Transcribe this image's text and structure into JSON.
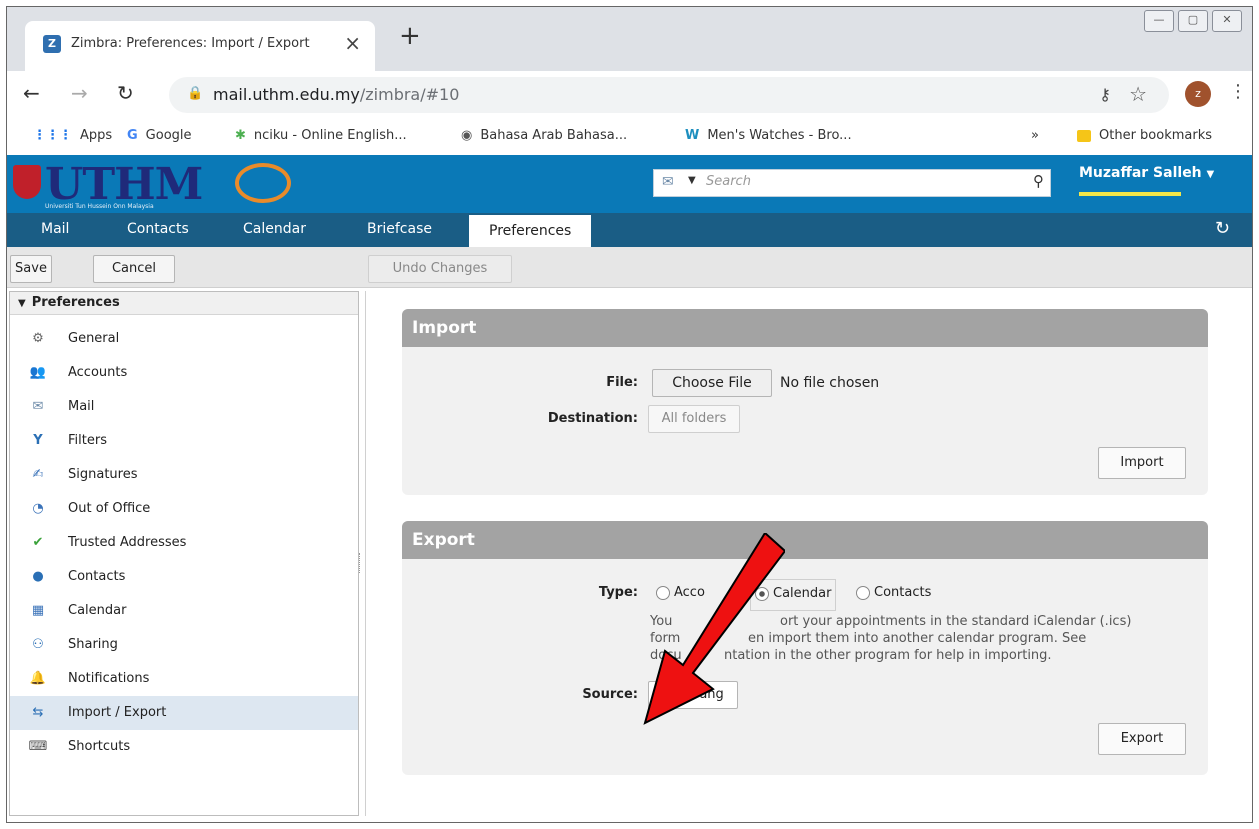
{
  "browser": {
    "tab_title": "Zimbra: Preferences: Import / Export",
    "favicon_text": "Z",
    "url_host": "mail.uthm.edu.my",
    "url_path": "/zimbra/#10",
    "avatar_letter": "z",
    "bookmarks": [
      {
        "label": "Apps",
        "icon": "apps-grid-icon"
      },
      {
        "label": "Google",
        "icon": "google-icon"
      },
      {
        "label": "nciku - Online English...",
        "icon": "nciku-icon"
      },
      {
        "label": "Bahasa Arab Bahasa...",
        "icon": "globe-icon"
      },
      {
        "label": "Men's Watches - Bro...",
        "icon": "w-icon"
      }
    ],
    "more_bookmarks": "»",
    "other_bookmarks": "Other bookmarks"
  },
  "header": {
    "logo_text": "UTHM",
    "logo_subtext": "Universiti Tun Hussein Onn Malaysia",
    "search_placeholder": "Search",
    "user_name": "Muzaffar Salleh"
  },
  "nav": {
    "tabs": [
      "Mail",
      "Contacts",
      "Calendar",
      "Briefcase",
      "Preferences"
    ],
    "active": "Preferences"
  },
  "actions": {
    "save": "Save",
    "cancel": "Cancel",
    "undo": "Undo Changes"
  },
  "sidebar": {
    "title": "Preferences",
    "items": [
      {
        "label": "General",
        "icon": "gear-icon"
      },
      {
        "label": "Accounts",
        "icon": "accounts-icon"
      },
      {
        "label": "Mail",
        "icon": "envelope-icon"
      },
      {
        "label": "Filters",
        "icon": "filter-icon"
      },
      {
        "label": "Signatures",
        "icon": "signature-icon"
      },
      {
        "label": "Out of Office",
        "icon": "out-of-office-icon"
      },
      {
        "label": "Trusted Addresses",
        "icon": "shield-check-icon"
      },
      {
        "label": "Contacts",
        "icon": "person-icon"
      },
      {
        "label": "Calendar",
        "icon": "calendar-icon"
      },
      {
        "label": "Sharing",
        "icon": "sharing-icon"
      },
      {
        "label": "Notifications",
        "icon": "bell-icon"
      },
      {
        "label": "Import / Export",
        "icon": "import-export-icon"
      },
      {
        "label": "Shortcuts",
        "icon": "keyboard-shortcut-icon"
      }
    ],
    "selected": "Import / Export"
  },
  "import": {
    "title": "Import",
    "file_label": "File:",
    "choose_file": "Choose File",
    "no_file": "No file chosen",
    "destination_label": "Destination:",
    "destination_value": "All folders",
    "button": "Import"
  },
  "export": {
    "title": "Export",
    "type_label": "Type:",
    "type_options": [
      "Acco",
      "Calendar",
      "Contacts"
    ],
    "selected_type": "Calendar",
    "hint_lines": [
      "You",
      "ort your appointments in the standard iCalendar (.ics)",
      "form",
      "en import them into another calendar program. See",
      "docu",
      "ntation in the other program for help in importing."
    ],
    "source_label": "Source:",
    "source_value": "bambang",
    "button": "Export"
  },
  "colors": {
    "header_blue": "#0a79b7",
    "nav_blue": "#1a5d85",
    "panel_header": "#a3a3a3",
    "arrow_red": "#ee1111"
  }
}
